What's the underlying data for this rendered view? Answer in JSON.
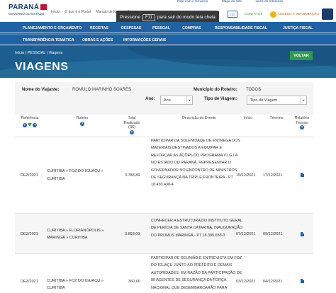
{
  "header": {
    "brand": "PARANÁ",
    "brand_sub": "GOVERNO DO ESTADO",
    "topnav": [
      "Início",
      "O que é o Portal",
      "Manual de Navegação"
    ],
    "toplinks": [
      "Fale com o Governo",
      "Mapa do Site",
      "Links de Interesse"
    ],
    "lai": "LAI",
    "contatos": "CONTATOS",
    "accessibility": "ACESSO À INFORMAÇÃO"
  },
  "toast": {
    "before": "Pressione",
    "key": "F11",
    "after": "para sair do modo tela cheia"
  },
  "nav": {
    "row1": [
      "PLANEJAMENTO E ORÇAMENTO",
      "RECEITAS",
      "DESPESAS",
      "PESSOAL",
      "COMPRAS",
      "RESPONSABILIDADE FISCAL",
      "JUSTIÇA FISCAL"
    ],
    "row2": [
      "TRANSPARÊNCIA TEMÁTICA",
      "OBRAS E AÇÕES",
      "INFORMAÇÕES GERAIS"
    ]
  },
  "breadcrumb": "Início | PESSOAL | Viagens",
  "page_title": "VIAGENS",
  "back_button": "VOLTAR",
  "filters": {
    "traveler_label": "Nome do Viajante:",
    "traveler_value": "ROMULO MARINHO SOARES",
    "municipio_label": "Município do Roteiro:",
    "municipio_value": "TODOS",
    "ano_label": "Ano:",
    "ano_value": "Ano",
    "tipo_label": "Tipo de Viagem:",
    "tipo_value": "Tipo de Viagem"
  },
  "table": {
    "headers": {
      "referencia": "Referência",
      "roteiro": "Roteiro",
      "total": [
        "Total",
        "Realizado",
        "(R$)"
      ],
      "descricao": "Descrição do Evento",
      "inicio": "Início",
      "termino": "Término",
      "relatorio": [
        "Relatório",
        "Técnico"
      ]
    },
    "rows": [
      {
        "referencia": "DEZ/2021",
        "roteiro_1": "CURITIBA » FOZ DO IGUAÇU »",
        "roteiro_2": "CURITIBA",
        "total": "3.788,89",
        "descricao": "PARTICIPAR DA SOLENIDADE DE ENTREGA DOS MATERIAIS DESTINADOS A EQUIPAR E REFORÇAR AS AÇÕES DO PROGRAMA V.I.G.I.A NO ESTADO DO PARANÁ, REPRESENTAR O GOVERNADOR NO ENCONTRO DE MINISTROS DE SEGURANÇA NA TRIPLE FRONTEIRA - PT 18.430.438-4",
        "inicio": "15/12/2021",
        "termino": "17/12/2021"
      },
      {
        "referencia": "DEZ/2021",
        "roteiro_1": "CURITIBA » FLORIANÓPOLIS »",
        "roteiro_2": "MARINGÁ » CURITIBA",
        "total": "3.893,09",
        "descricao": "CONHECER A ESTRUTURA DO INSTITUTO GERAL DE PERÍCIA DE SANTA CATARINA, INAUGURAÇÃO DO PRUMUS MARINGÁ - PT 18.399.653-3",
        "inicio": "07/12/2021",
        "termino": "09/12/2021"
      },
      {
        "referencia": "DEZ/2021",
        "roteiro_1": "CURITIBA » FOZ DO IGUAÇU »",
        "roteiro_2": "CURITIBA",
        "total": "360,00",
        "descricao": "PARTICIPAR DE REUNIÃO E ENTREVISTA EM FOZ DO IGUAÇU JUNTO AO PREFEITO E DEMAIS AUTORIDADES, EM RAZÃO DA PARTICIPAÇÃO DE 80 AGENTES DE SEGURANÇA DA FORÇA NACIONAL QUE DESEMBARCARÃO PARA REFORÇAR",
        "inicio": "03/12/2021",
        "termino": "04/12/2021"
      }
    ]
  },
  "colors": {
    "nav_blue": "#1d63a5",
    "hero_blue": "#1c5e8f",
    "back_green": "#2e9b4a",
    "icon_blue": "#1d63a5"
  }
}
